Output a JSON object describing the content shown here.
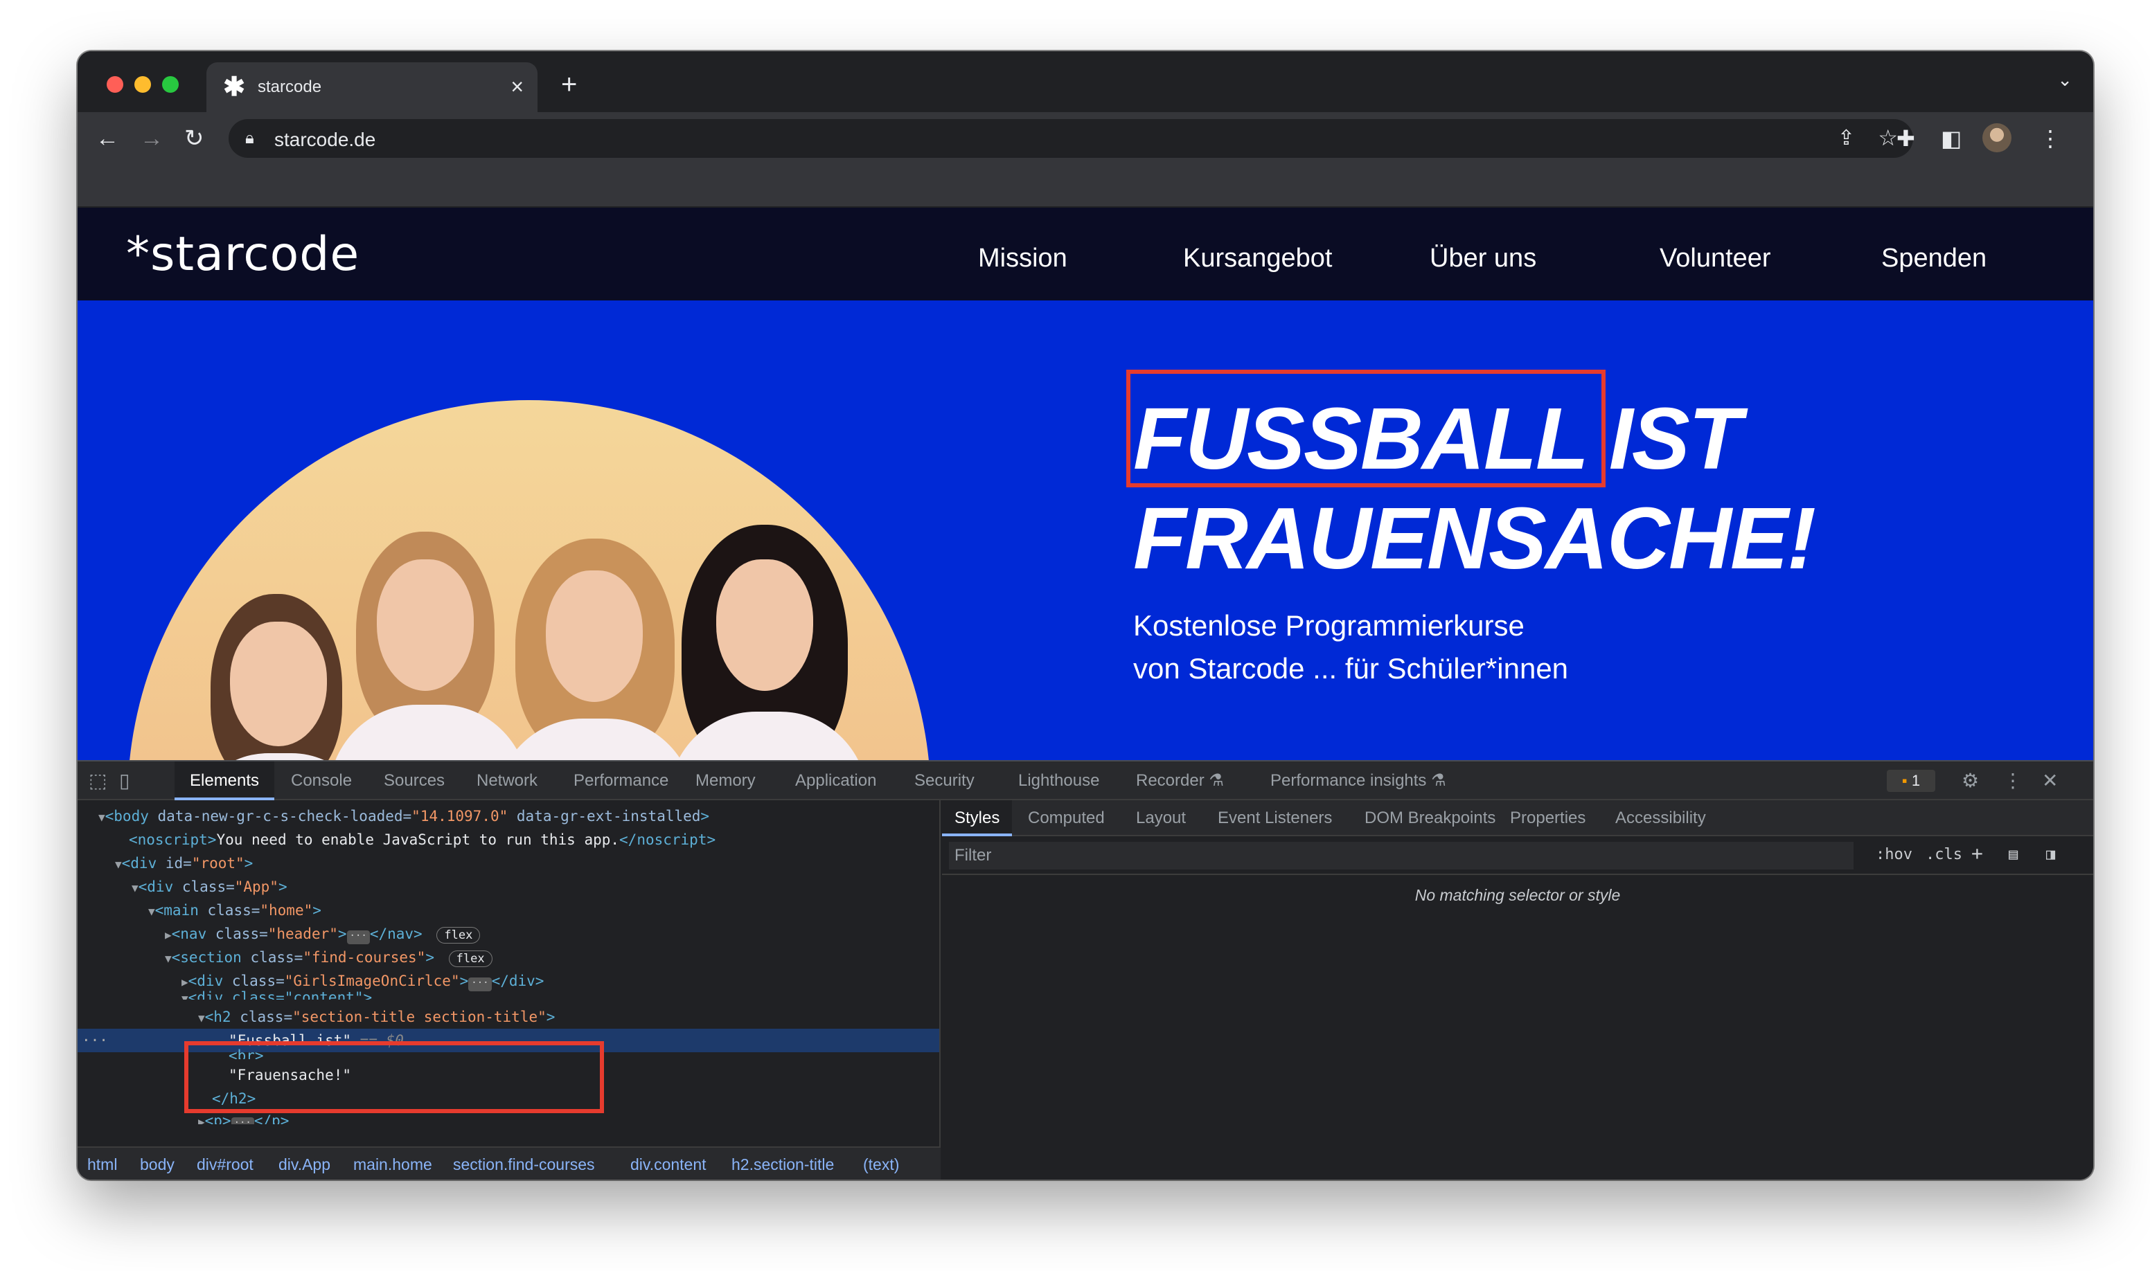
{
  "browser": {
    "tab_title": "starcode",
    "new_tab": "+",
    "url": "starcode.de"
  },
  "site": {
    "logo": "*starcode",
    "nav": [
      "Mission",
      "Kursangebot",
      "Über uns",
      "Volunteer",
      "Spenden"
    ],
    "hero_title_line1a": "FUSSBALL",
    "hero_title_line1b": "IST",
    "hero_title_line2": "FRAUENSACHE!",
    "hero_subtitle": "Kostenlose Programmierkurse",
    "hero_subtitle_cut": "von Starcode ... für Schüler*innen"
  },
  "devtools": {
    "tabs": [
      "Elements",
      "Console",
      "Sources",
      "Network",
      "Performance",
      "Memory",
      "Application",
      "Security",
      "Lighthouse",
      "Recorder",
      "Performance insights"
    ],
    "issues_count": "1",
    "dom": {
      "l1_tag": "<body",
      "l1_attr1": "data-new-gr-c-s-check-loaded=",
      "l1_val1": "\"14.1097.0\"",
      "l1_attr2": "data-gr-ext-installed",
      "l1_end": ">",
      "l2_open": "<noscript>",
      "l2_text": "You need to enable JavaScript to run this app.",
      "l2_close": "</noscript>",
      "l3_tag": "<div",
      "l3_attr": "id=",
      "l3_val": "\"root\"",
      "l4_tag": "<div",
      "l4_attr": "class=",
      "l4_val": "\"App\"",
      "l5_tag": "<main",
      "l5_attr": "class=",
      "l5_val": "\"home\"",
      "l6_tag": "<nav",
      "l6_attr": "class=",
      "l6_val": "\"header\"",
      "l6_close": "</nav>",
      "l7_tag": "<section",
      "l7_attr": "class=",
      "l7_val": "\"find-courses\"",
      "l8_tag": "<div",
      "l8_attr": "class=",
      "l8_val": "\"GirlsImageOnCirlce\"",
      "l8_close": "</div>",
      "l9_partial": "<div class=\"content\">",
      "l10_tag": "<h2",
      "l10_attr": "class=",
      "l10_val": "\"section-title section-title\"",
      "l11_text": "\"Fussball ist\"",
      "l11_ref": "== $0",
      "l12_partial": "<br>",
      "l13_text": "\"Frauensache!\"",
      "l14_close": "</h2>",
      "l15_tag": "<p>",
      "l15_close": "</p>",
      "pill_flex": "flex",
      "ellipsis": "···",
      "gt": ">",
      "gutter": "···"
    },
    "breadcrumbs": [
      "html",
      "body",
      "div#root",
      "div.App",
      "main.home",
      "section.find-courses",
      "div.content",
      "h2.section-title",
      "(text)"
    ],
    "styles_tabs": [
      "Styles",
      "Computed",
      "Layout",
      "Event Listeners",
      "DOM Breakpoints",
      "Properties",
      "Accessibility"
    ],
    "filter_placeholder": "Filter",
    "hov": ":hov",
    "cls": ".cls",
    "no_match": "No matching selector or style"
  },
  "colors": {
    "page_blue": "#0029d6",
    "site_nav": "#0a0c24",
    "highlight_red": "#e63b2e"
  },
  "icons": [
    "close-icon",
    "back-icon",
    "forward-icon",
    "reload-icon",
    "lock-icon",
    "share-icon",
    "star-icon",
    "extensions-icon",
    "side-panel-icon",
    "menu-icon",
    "inspect-icon",
    "device-icon",
    "settings-icon"
  ]
}
